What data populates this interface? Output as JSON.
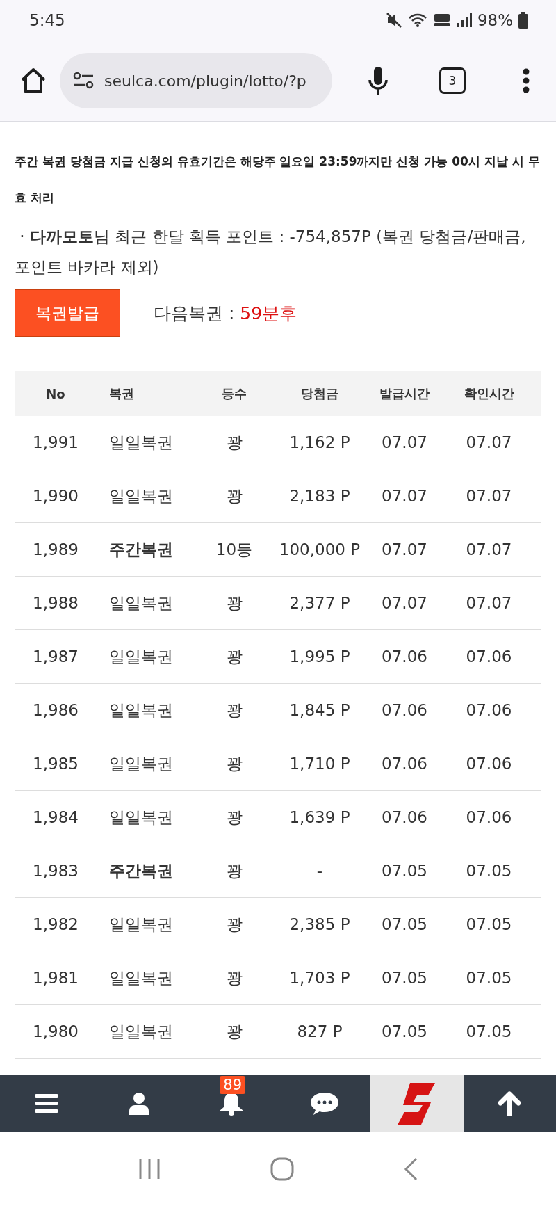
{
  "status_bar": {
    "time": "5:45",
    "battery": "98%"
  },
  "browser": {
    "url": "seulca.com/plugin/lotto/?p",
    "tab_count": "3"
  },
  "notice": "주간 복권 당첨금 지급 신청의 유효기간은 해당주 일요일 23:59까지만 신청 가능 00시 지날 시 무효 처리",
  "points": {
    "bullet": "·",
    "user": "다까모토",
    "text": "님 최근 한달 획득 포인트 : -754,857P (복권 당첨금/판매금, 포인트 바카라 제외)"
  },
  "issue_button": "복권발급",
  "next": {
    "label": "다음복권 : ",
    "value": "59분후"
  },
  "table": {
    "columns": [
      "No",
      "복권",
      "등수",
      "당첨금",
      "발급시간",
      "확인시간"
    ],
    "rows": [
      {
        "no": "1,991",
        "ticket": "일일복권",
        "kind": "daily",
        "rank": "꽝",
        "prize": "1,162 P",
        "issued": "07.07",
        "checked_at": "07.07"
      },
      {
        "no": "1,990",
        "ticket": "일일복권",
        "kind": "daily",
        "rank": "꽝",
        "prize": "2,183 P",
        "issued": "07.07",
        "checked_at": "07.07"
      },
      {
        "no": "1,989",
        "ticket": "주간복권",
        "kind": "weekly",
        "rank": "10등",
        "prize": "100,000 P",
        "issued": "07.07",
        "checked_at": "07.07"
      },
      {
        "no": "1,988",
        "ticket": "일일복권",
        "kind": "daily",
        "rank": "꽝",
        "prize": "2,377 P",
        "issued": "07.07",
        "checked_at": "07.07"
      },
      {
        "no": "1,987",
        "ticket": "일일복권",
        "kind": "daily",
        "rank": "꽝",
        "prize": "1,995 P",
        "issued": "07.06",
        "checked_at": "07.06"
      },
      {
        "no": "1,986",
        "ticket": "일일복권",
        "kind": "daily",
        "rank": "꽝",
        "prize": "1,845 P",
        "issued": "07.06",
        "checked_at": "07.06"
      },
      {
        "no": "1,985",
        "ticket": "일일복권",
        "kind": "daily",
        "rank": "꽝",
        "prize": "1,710 P",
        "issued": "07.06",
        "checked_at": "07.06"
      },
      {
        "no": "1,984",
        "ticket": "일일복권",
        "kind": "daily",
        "rank": "꽝",
        "prize": "1,639 P",
        "issued": "07.06",
        "checked_at": "07.06"
      },
      {
        "no": "1,983",
        "ticket": "주간복권",
        "kind": "weekly",
        "rank": "꽝",
        "prize": "-",
        "issued": "07.05",
        "checked_at": "07.05"
      },
      {
        "no": "1,982",
        "ticket": "일일복권",
        "kind": "daily",
        "rank": "꽝",
        "prize": "2,385 P",
        "issued": "07.05",
        "checked_at": "07.05"
      },
      {
        "no": "1,981",
        "ticket": "일일복권",
        "kind": "daily",
        "rank": "꽝",
        "prize": "1,703 P",
        "issued": "07.05",
        "checked_at": "07.05"
      },
      {
        "no": "1,980",
        "ticket": "일일복권",
        "kind": "daily",
        "rank": "꽝",
        "prize": "827 P",
        "issued": "07.05",
        "checked_at": "07.05"
      }
    ]
  },
  "bottom_nav": {
    "notification_count": "89"
  }
}
